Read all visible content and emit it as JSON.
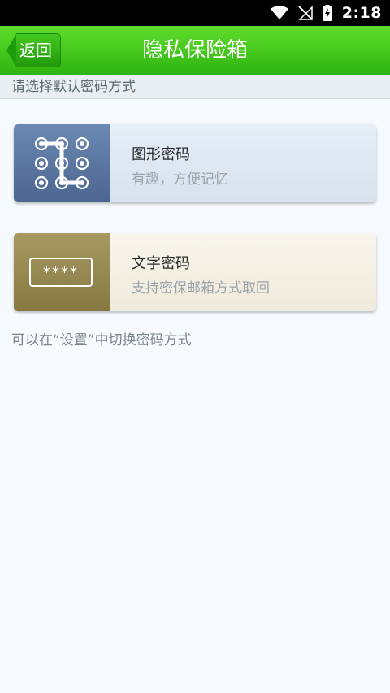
{
  "status_bar": {
    "time": "2:18",
    "icons": [
      "wifi-icon",
      "no-signal-icon",
      "battery-charging-icon"
    ]
  },
  "header": {
    "back_label": "返回",
    "title": "隐私保险箱"
  },
  "section": {
    "header": "请选择默认密码方式"
  },
  "options": [
    {
      "title": "图形密码",
      "subtitle": "有趣，方便记忆",
      "icon": "pattern-lock-icon"
    },
    {
      "title": "文字密码",
      "subtitle": "支持密保邮箱方式取回",
      "icon": "password-field-icon",
      "mask": "****"
    }
  ],
  "footer_hint": "可以在“设置”中切换密码方式",
  "colors": {
    "title_bar": "#3cc41a",
    "pattern_icon_bg": "#5a78a2",
    "text_icon_bg": "#958950",
    "page_bg": "#f6faff"
  }
}
